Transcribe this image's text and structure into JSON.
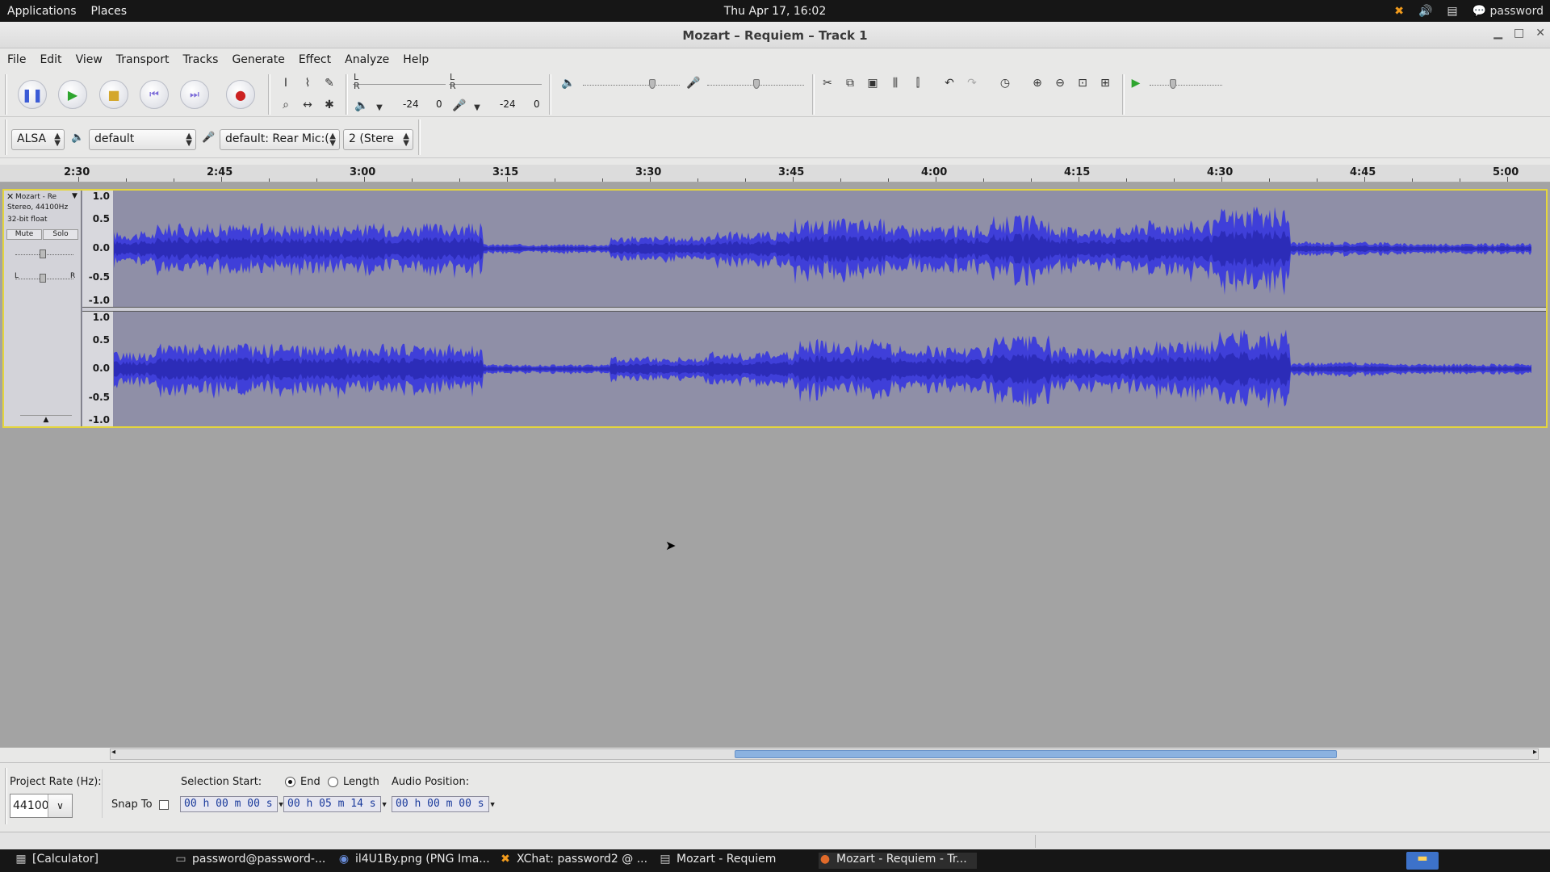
{
  "top_panel": {
    "menus": [
      "Applications",
      "Places"
    ],
    "clock": "Thu Apr 17, 16:02",
    "user": "password"
  },
  "window": {
    "title": "Mozart – Requiem – Track  1"
  },
  "menubar": [
    "File",
    "Edit",
    "View",
    "Transport",
    "Tracks",
    "Generate",
    "Effect",
    "Analyze",
    "Help"
  ],
  "meters": {
    "playback_left": "-24",
    "playback_right": "0",
    "record_left": "-24",
    "record_right": "0",
    "l": "L",
    "r": "R"
  },
  "device_toolbar": {
    "host": "ALSA",
    "output": "default",
    "input": "default: Rear Mic:(",
    "channels": "2 (Stere"
  },
  "timeline": {
    "ticks": [
      "2:30",
      "2:45",
      "3:00",
      "3:15",
      "3:30",
      "3:45",
      "4:00",
      "4:15",
      "4:30",
      "4:45",
      "5:00"
    ]
  },
  "track": {
    "name": "Mozart - Re",
    "format1": "Stereo, 44100Hz",
    "format2": "32-bit float",
    "mute": "Mute",
    "solo": "Solo",
    "pan_l": "L",
    "pan_r": "R",
    "scale": [
      "1.0",
      "0.5",
      "0.0",
      "-0.5",
      "-1.0"
    ],
    "colors": {
      "wave": "#3f3fd9",
      "wave_dark": "#2c2cb8",
      "background": "#8f8fa7",
      "selected_border": "#e4d53d"
    }
  },
  "selection_toolbar": {
    "project_rate_label": "Project Rate (Hz):",
    "project_rate": "44100",
    "snap_to_label": "Snap To",
    "selection_start_label": "Selection Start:",
    "end_label": "End",
    "length_label": "Length",
    "audio_position_label": "Audio Position:",
    "selection_start": "00 h 00 m 00 s",
    "selection_end": "00 h 05 m 14 s",
    "audio_position": "00 h 00 m 00 s"
  },
  "taskbar": [
    {
      "label": "[Calculator]",
      "icon": "calculator-icon"
    },
    {
      "label": "password@password-...",
      "icon": "terminal-icon"
    },
    {
      "label": "il4U1By.png (PNG Ima...",
      "icon": "browser-icon"
    },
    {
      "label": "XChat: password2 @ ...",
      "icon": "xchat-icon"
    },
    {
      "label": "Mozart - Requiem",
      "icon": "folder-icon"
    },
    {
      "label": "Mozart - Requiem - Tr...",
      "icon": "audacity-icon"
    }
  ]
}
